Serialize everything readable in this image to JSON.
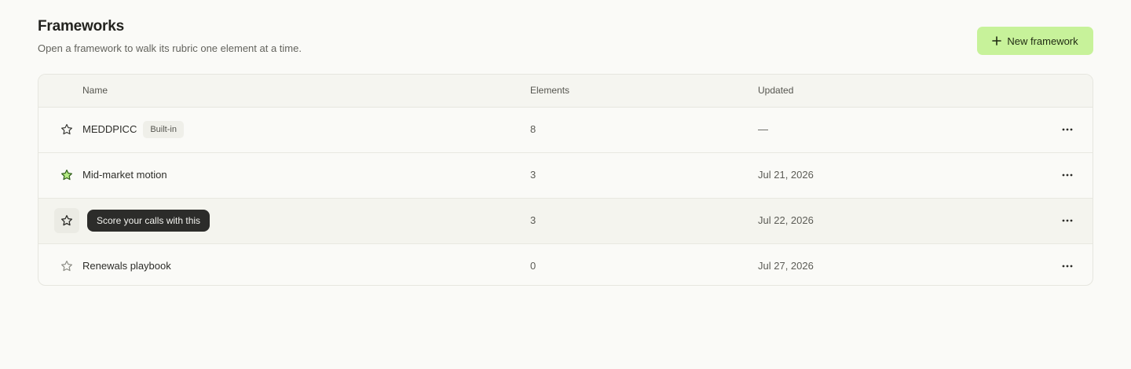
{
  "header": {
    "title": "Frameworks",
    "subtitle": "Open a framework to walk its rubric one element at a time.",
    "new_button_label": "New framework",
    "new_button_icon": "plus-icon"
  },
  "table": {
    "columns": {
      "name": "Name",
      "elements": "Elements",
      "updated": "Updated"
    },
    "rows": [
      {
        "name": "MEDDPICC",
        "badge": "Built-in",
        "elements": "8",
        "updated": "—",
        "starred": false
      },
      {
        "name": "Mid-market motion",
        "elements": "3",
        "updated": "Jul 21, 2026",
        "starred": true
      },
      {
        "name": "",
        "elements": "3",
        "updated": "Jul 22, 2026",
        "starred": false
      },
      {
        "name": "Renewals playbook",
        "elements": "0",
        "updated": "Jul 27, 2026",
        "starred": false
      }
    ]
  },
  "tooltip": {
    "text": "Score your calls with this"
  },
  "colors": {
    "accent": "#c7f29a",
    "starred_fill": "#b6ec84",
    "starred_stroke": "#2f5d1a",
    "tooltip_bg": "#2c2c2a"
  }
}
